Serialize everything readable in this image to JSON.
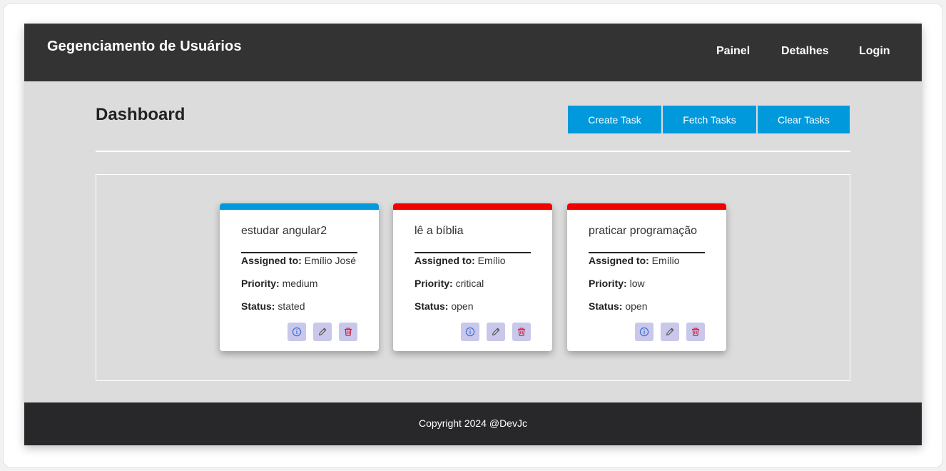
{
  "navbar": {
    "brand": "Gegenciamento de Usuários",
    "links": [
      "Painel",
      "Detalhes",
      "Login"
    ]
  },
  "dashboard": {
    "title": "Dashboard",
    "buttons": {
      "create": "Create Task",
      "fetch": "Fetch Tasks",
      "clear": "Clear Tasks"
    },
    "button_color": "#0099dc"
  },
  "labels": {
    "assigned": "Assigned to:",
    "priority": "Priority:",
    "status": "Status:"
  },
  "tasks": [
    {
      "title": "estudar angular2",
      "assigned": "Emílio José",
      "priority": "medium",
      "status": "stated",
      "accent_color": "#0099dc",
      "icons": [
        "info-icon",
        "pencil-icon",
        "trash-icon"
      ]
    },
    {
      "title": "lê a bíblia",
      "assigned": "Emílio",
      "priority": "critical",
      "status": "open",
      "accent_color": "#f20000",
      "icons": [
        "info-icon",
        "pencil-icon",
        "trash-icon"
      ]
    },
    {
      "title": "praticar programação",
      "assigned": "Emílio",
      "priority": "low",
      "status": "open",
      "accent_color": "#f20000",
      "icons": [
        "info-icon",
        "pencil-icon",
        "trash-icon"
      ]
    }
  ],
  "footer": {
    "text": "Copyright 2024 @DevJc"
  },
  "colors": {
    "navbar": "#333333",
    "page_bg": "#dcdcdc",
    "footer": "#28282a",
    "icon_button_bg": "#c9c7ea",
    "info_icon": "#3b6fd8",
    "edit_icon": "#555555",
    "delete_icon": "#d01c3a"
  }
}
